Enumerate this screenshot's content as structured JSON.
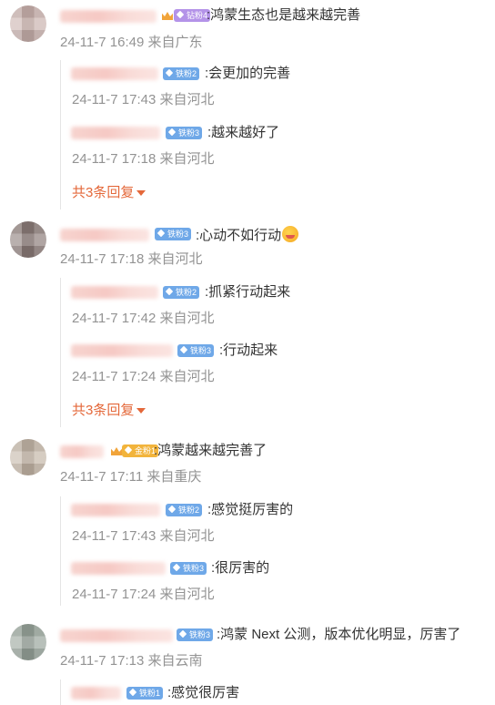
{
  "comments": [
    {
      "text": ":鸿蒙生态也是越来越完善",
      "meta": "24-11-7 16:49 来自广东",
      "badge": "钻粉4",
      "replies": [
        {
          "badge": "铁粉2",
          "text": ":会更加的完善",
          "meta": "24-11-7 17:43 来自河北"
        },
        {
          "badge": "铁粉3",
          "text": ":越来越好了",
          "meta": "24-11-7 17:18 来自河北"
        }
      ],
      "more": "共3条回复"
    },
    {
      "text": ":心动不如行动",
      "meta": "24-11-7 17:18 来自河北",
      "badge": "铁粉3",
      "replies": [
        {
          "badge": "铁粉2",
          "text": ":抓紧行动起来",
          "meta": "24-11-7 17:42 来自河北"
        },
        {
          "badge": "铁粉3",
          "text": ":行动起来",
          "meta": "24-11-7 17:24 来自河北"
        }
      ],
      "more": "共3条回复"
    },
    {
      "text": ":鸿蒙越来越完善了",
      "meta": "24-11-7 17:11 来自重庆",
      "badge": "金粉1",
      "replies": [
        {
          "badge": "铁粉2",
          "text": ":感觉挺厉害的",
          "meta": "24-11-7 17:43 来自河北"
        },
        {
          "badge": "铁粉3",
          "text": ":很厉害的",
          "meta": "24-11-7 17:24 来自河北"
        }
      ]
    },
    {
      "text": ":鸿蒙 Next 公测，版本优化明显，厉害了",
      "meta": "24-11-7 17:13 来自云南",
      "badge": "铁粉3",
      "replies": [
        {
          "badge": "铁粉1",
          "text": ":感觉很厉害",
          "meta": ""
        }
      ]
    }
  ]
}
